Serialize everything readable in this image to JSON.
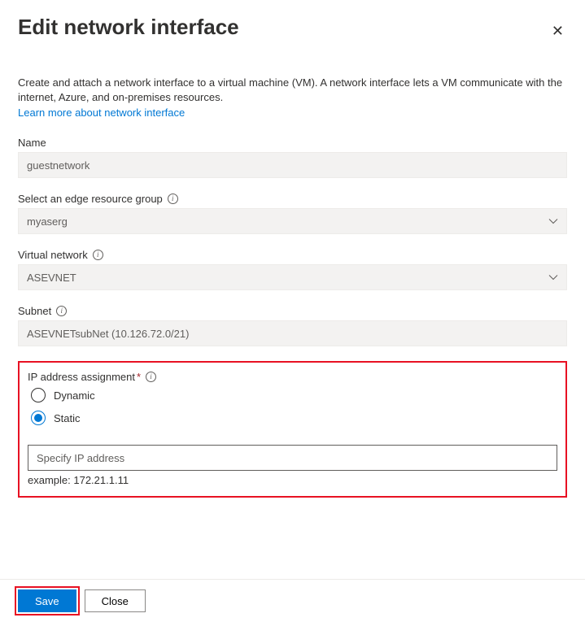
{
  "header": {
    "title": "Edit network interface"
  },
  "description": "Create and attach a network interface to a virtual machine (VM). A network interface lets a VM communicate with the internet, Azure, and on-premises resources.",
  "learn_more": "Learn more about network interface",
  "fields": {
    "name": {
      "label": "Name",
      "value": "guestnetwork"
    },
    "resource_group": {
      "label": "Select an edge resource group",
      "value": "myaserg"
    },
    "vnet": {
      "label": "Virtual network",
      "value": "ASEVNET"
    },
    "subnet": {
      "label": "Subnet",
      "value": "ASEVNETsubNet (10.126.72.0/21)"
    },
    "ip_assignment": {
      "label": "IP address assignment",
      "options": {
        "dynamic": "Dynamic",
        "static": "Static"
      },
      "ip_placeholder": "Specify IP address",
      "example": "example: 172.21.1.11"
    }
  },
  "footer": {
    "save": "Save",
    "close": "Close"
  }
}
